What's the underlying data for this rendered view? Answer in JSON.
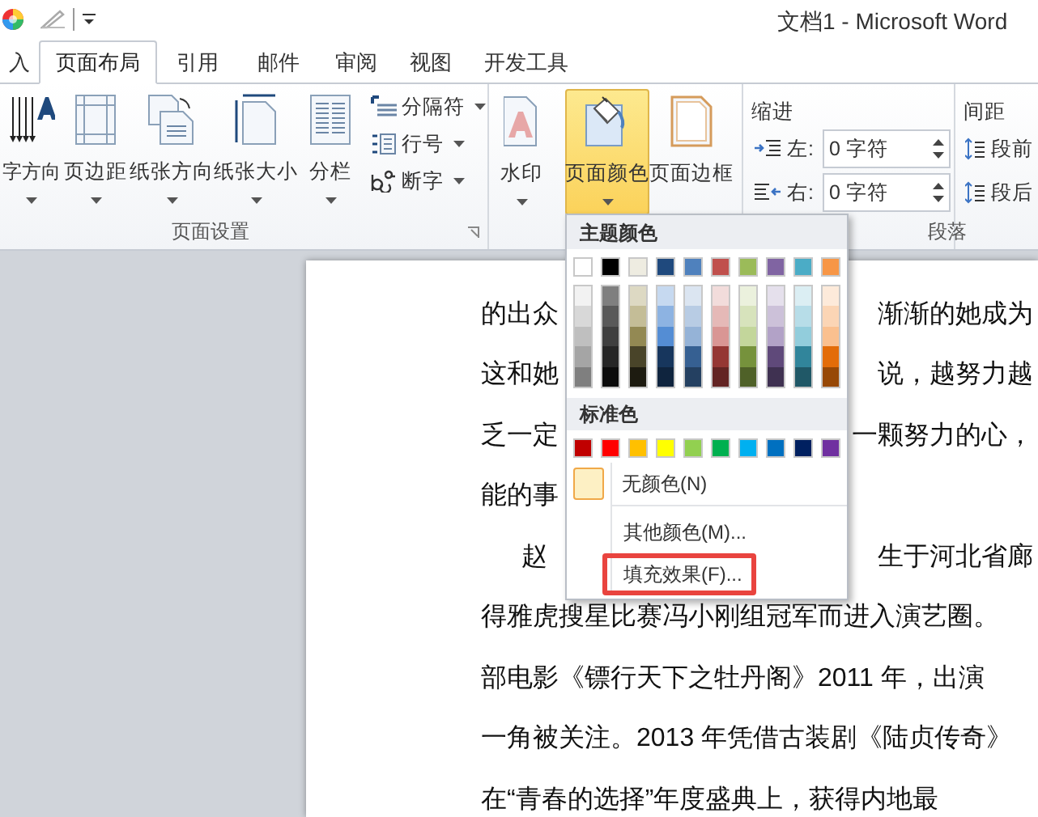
{
  "window": {
    "title": "文档1 - Microsoft Word"
  },
  "tabs": [
    {
      "label": "入",
      "selected": false
    },
    {
      "label": "页面布局",
      "selected": true
    },
    {
      "label": "引用",
      "selected": false
    },
    {
      "label": "邮件",
      "selected": false
    },
    {
      "label": "审阅",
      "selected": false
    },
    {
      "label": "视图",
      "selected": false
    },
    {
      "label": "开发工具",
      "selected": false
    }
  ],
  "page_setup": {
    "label": "页面设置",
    "buttons": [
      {
        "label": "字方向",
        "dropdown": true
      },
      {
        "label": "页边距",
        "dropdown": true
      },
      {
        "label": "纸张方向",
        "dropdown": true
      },
      {
        "label": "纸张大小",
        "dropdown": true
      },
      {
        "label": "分栏",
        "dropdown": true
      }
    ],
    "small_buttons": [
      {
        "label": "分隔符",
        "dropdown": true
      },
      {
        "label": "行号",
        "dropdown": true
      },
      {
        "label": "断字",
        "dropdown": true
      }
    ]
  },
  "page_background": {
    "buttons": [
      {
        "label": "水印",
        "dropdown": true,
        "pressed": false
      },
      {
        "label": "页面颜色",
        "dropdown": true,
        "pressed": true
      },
      {
        "label": "页面边框",
        "dropdown": false,
        "pressed": false
      }
    ]
  },
  "paragraph": {
    "label": "段落",
    "indent": {
      "label": "缩进",
      "fields": [
        {
          "label": "左:",
          "value": "0 字符"
        },
        {
          "label": "右:",
          "value": "0 字符"
        }
      ]
    },
    "spacing": {
      "label": "间距",
      "items": [
        "段前",
        "段后"
      ]
    }
  },
  "document": {
    "lines": [
      {
        "kind": "split",
        "left": "的出众",
        "right": "渐渐的她成为",
        "indent": false
      },
      {
        "kind": "split",
        "left": "这和她",
        "right": "说，越努力越",
        "indent": false
      },
      {
        "kind": "split",
        "left": "乏一定",
        "right": "一颗努力的心，",
        "indent": false
      },
      {
        "kind": "split",
        "left": "能的事",
        "indent": false
      },
      {
        "kind": "split",
        "left": "赵",
        "right": "生于河北省廊",
        "indent": true
      },
      {
        "kind": "full",
        "text": "得雅虎搜星比赛冯小刚组冠军而进入演艺圈。",
        "indent": false
      },
      {
        "kind": "full",
        "text": "部电影《镖行天下之牡丹阁》2011 年，出演",
        "indent": false
      },
      {
        "kind": "full",
        "text": "一角被关注。2013 年凭借古装剧《陆贞传奇》",
        "indent": false
      },
      {
        "kind": "full",
        "text": "在“青春的选择”年度盛典上，获得内地最",
        "indent": false
      }
    ]
  },
  "menu": {
    "theme_header": "主题颜色",
    "theme_colors": [
      {
        "color": "#ffffff",
        "shades": [
          {
            "color": "#f2f2f2"
          },
          {
            "color": "#d8d8d8"
          },
          {
            "color": "#bfbfbf"
          },
          {
            "color": "#a5a5a5"
          },
          {
            "color": "#7f7f7f"
          }
        ]
      },
      {
        "color": "#000000",
        "shades": [
          {
            "color": "#7f7f7f"
          },
          {
            "color": "#595959"
          },
          {
            "color": "#3f3f3f"
          },
          {
            "color": "#262626"
          },
          {
            "color": "#0c0c0c"
          }
        ]
      },
      {
        "color": "#eeece1",
        "shades": [
          {
            "color": "#ddd9c3"
          },
          {
            "color": "#c4bd97"
          },
          {
            "color": "#938953"
          },
          {
            "color": "#494429"
          },
          {
            "color": "#1d1b10"
          }
        ]
      },
      {
        "color": "#1f497d",
        "shades": [
          {
            "color": "#c6d9f0"
          },
          {
            "color": "#8db3e2"
          },
          {
            "color": "#548dd4"
          },
          {
            "color": "#17365d"
          },
          {
            "color": "#0f243e"
          }
        ]
      },
      {
        "color": "#4f81bd",
        "shades": [
          {
            "color": "#dbe5f1"
          },
          {
            "color": "#b8cce4"
          },
          {
            "color": "#95b3d7"
          },
          {
            "color": "#366092"
          },
          {
            "color": "#244061"
          }
        ]
      },
      {
        "color": "#c0504d",
        "shades": [
          {
            "color": "#f2dcdb"
          },
          {
            "color": "#e5b9b7"
          },
          {
            "color": "#d99694"
          },
          {
            "color": "#953734"
          },
          {
            "color": "#632423"
          }
        ]
      },
      {
        "color": "#9bbb59",
        "shades": [
          {
            "color": "#ebf1dd"
          },
          {
            "color": "#d7e3bc"
          },
          {
            "color": "#c3d69b"
          },
          {
            "color": "#76923c"
          },
          {
            "color": "#4f6128"
          }
        ]
      },
      {
        "color": "#8064a2",
        "shades": [
          {
            "color": "#e5e0ec"
          },
          {
            "color": "#ccc1d9"
          },
          {
            "color": "#b2a2c7"
          },
          {
            "color": "#5f497a"
          },
          {
            "color": "#3f3151"
          }
        ]
      },
      {
        "color": "#4bacc6",
        "shades": [
          {
            "color": "#dbeef3"
          },
          {
            "color": "#b7dde8"
          },
          {
            "color": "#92cddc"
          },
          {
            "color": "#31859b"
          },
          {
            "color": "#205867"
          }
        ]
      },
      {
        "color": "#f79646",
        "shades": [
          {
            "color": "#fdeada"
          },
          {
            "color": "#fbd5b5"
          },
          {
            "color": "#fac08f"
          },
          {
            "color": "#e36c09"
          },
          {
            "color": "#974806"
          }
        ]
      }
    ],
    "standard_header": "标准色",
    "standard_colors": [
      {
        "color": "#c00000"
      },
      {
        "color": "#ff0000"
      },
      {
        "color": "#ffc000"
      },
      {
        "color": "#ffff00"
      },
      {
        "color": "#92d050"
      },
      {
        "color": "#00b050"
      },
      {
        "color": "#00b0f0"
      },
      {
        "color": "#0070c0"
      },
      {
        "color": "#002060"
      },
      {
        "color": "#7030a0"
      }
    ],
    "items": [
      {
        "kind": "no-color",
        "label": "无颜色(N)",
        "highlighted": false
      },
      {
        "kind": "plain",
        "label": "其他颜色(M)...",
        "highlighted": false
      },
      {
        "kind": "plain",
        "label": "填充效果(F)...",
        "highlighted": true
      }
    ]
  }
}
